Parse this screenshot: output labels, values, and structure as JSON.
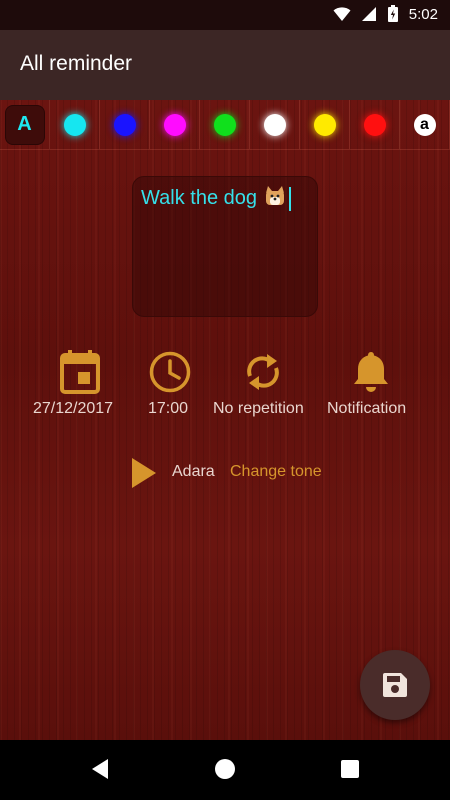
{
  "status": {
    "time": "5:02"
  },
  "app_bar": {
    "title": "All reminder"
  },
  "colors": {
    "font_toggle": "A",
    "swatches": [
      "#16e6f0",
      "#1a14ff",
      "#ff0cff",
      "#10e01c",
      "#ffffff",
      "#ffea00",
      "#ff1010"
    ],
    "alpha_label": "a"
  },
  "note": {
    "text": "Walk the dog",
    "text_color": "#35e0ea"
  },
  "options": {
    "date": "27/12/2017",
    "time": "17:00",
    "repeat": "No repetition",
    "reminder_type": "Notification"
  },
  "tone": {
    "name": "Adara",
    "change_label": "Change tone"
  },
  "accent": "#d6952c"
}
